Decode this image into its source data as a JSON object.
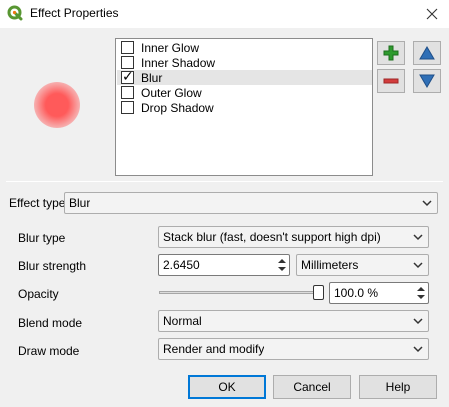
{
  "window": {
    "title": "Effect Properties",
    "app_icon": "qgis-logo-icon",
    "close_icon": "close-icon"
  },
  "effects_list": {
    "items": [
      {
        "label": "Inner Glow",
        "checked": false,
        "selected": false
      },
      {
        "label": "Inner Shadow",
        "checked": false,
        "selected": false
      },
      {
        "label": "Blur",
        "checked": true,
        "selected": true
      },
      {
        "label": "Outer Glow",
        "checked": false,
        "selected": false
      },
      {
        "label": "Drop Shadow",
        "checked": false,
        "selected": false
      }
    ]
  },
  "toolbar": {
    "add_icon": "plus-icon",
    "remove_icon": "minus-icon",
    "up_icon": "arrow-up-icon",
    "down_icon": "arrow-down-icon"
  },
  "effect_type": {
    "label": "Effect type",
    "value": "Blur"
  },
  "fields": {
    "blur_type": {
      "label": "Blur type",
      "value": "Stack blur (fast, doesn't support high dpi)"
    },
    "blur_strength": {
      "label": "Blur strength",
      "value": "2.6450",
      "unit": "Millimeters"
    },
    "opacity": {
      "label": "Opacity",
      "value": "100.0 %",
      "level": 1.0
    },
    "blend_mode": {
      "label": "Blend mode",
      "value": "Normal"
    },
    "draw_mode": {
      "label": "Draw mode",
      "value": "Render and modify"
    }
  },
  "buttons": {
    "ok": "OK",
    "cancel": "Cancel",
    "help": "Help"
  },
  "colors": {
    "preview": "#ff5a5a",
    "add_green": "#2e9b2e",
    "remove_red": "#d23c3c",
    "arrow_blue": "#2f6fb6",
    "qgis_green": "#589632"
  }
}
